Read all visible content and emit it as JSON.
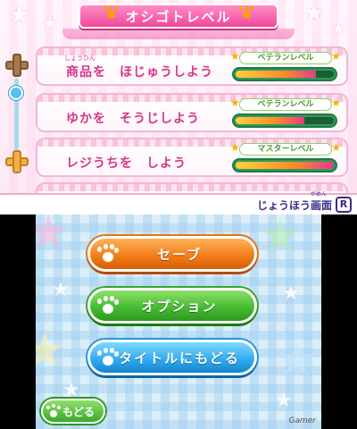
{
  "top": {
    "title": "オシゴトレベル",
    "tasks": [
      {
        "ruby": "しょうひん",
        "name": "商品を　ほじゅうしよう",
        "level": "ベテランレベル",
        "progress": 0.82
      },
      {
        "ruby": "",
        "name": "ゆかを　そうじしよう",
        "level": "ベテランレベル",
        "progress": 0.7
      },
      {
        "ruby": "",
        "name": "レジうちを　しよう",
        "level": "マスターレベル",
        "progress": 1.0
      }
    ],
    "info_ruby": "がめん",
    "info_label": "じょうほう画面",
    "r_button": "R"
  },
  "bottom": {
    "buttons": {
      "save": "セーブ",
      "options": "オプション",
      "title": "タイトルにもどる"
    },
    "back": "もどる",
    "watermark": "Gamer"
  },
  "colors": {
    "pink_accent": "#f0489b",
    "orange_button": "#f07a16",
    "green_button": "#43b830",
    "blue_button": "#2ea8ef"
  }
}
